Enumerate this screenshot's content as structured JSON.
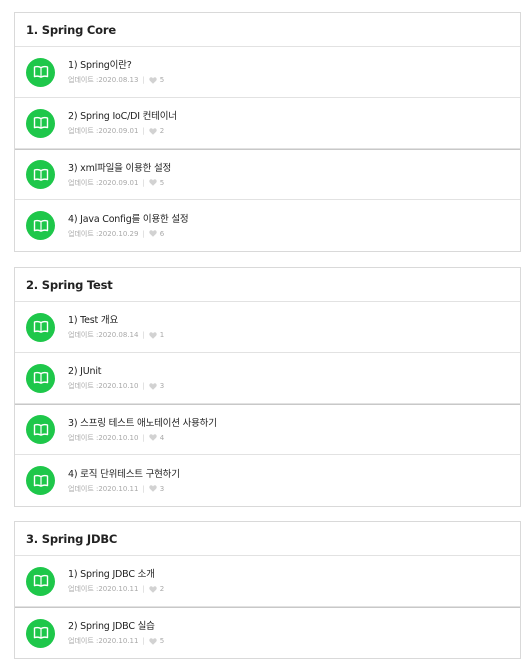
{
  "meta_label": "업데이트 : ",
  "colors": {
    "badge": "#1ec74a",
    "meta": "#a8a8a8",
    "border": "#d9d9d9"
  },
  "sections": [
    {
      "title": "1. Spring Core",
      "lessons": [
        {
          "title": "1) Spring이란?",
          "date": "2020.08.13",
          "likes": "5"
        },
        {
          "title": "2) Spring IoC/DI 컨테이너",
          "date": "2020.09.01",
          "likes": "2"
        },
        {
          "title": "3) xml파일을 이용한 설정",
          "date": "2020.09.01",
          "likes": "5"
        },
        {
          "title": "4) Java Config를 이용한 설정",
          "date": "2020.10.29",
          "likes": "6"
        }
      ]
    },
    {
      "title": "2. Spring Test",
      "lessons": [
        {
          "title": "1) Test 개요",
          "date": "2020.08.14",
          "likes": "1"
        },
        {
          "title": "2) JUnit",
          "date": "2020.10.10",
          "likes": "3"
        },
        {
          "title": "3) 스프링 테스트 애노테이션 사용하기",
          "date": "2020.10.10",
          "likes": "4"
        },
        {
          "title": "4) 로직 단위테스트 구현하기",
          "date": "2020.10.11",
          "likes": "3"
        }
      ]
    },
    {
      "title": "3. Spring JDBC",
      "lessons": [
        {
          "title": "1) Spring JDBC 소개",
          "date": "2020.10.11",
          "likes": "2"
        },
        {
          "title": "2) Spring JDBC 실습",
          "date": "2020.10.11",
          "likes": "5"
        }
      ]
    }
  ]
}
